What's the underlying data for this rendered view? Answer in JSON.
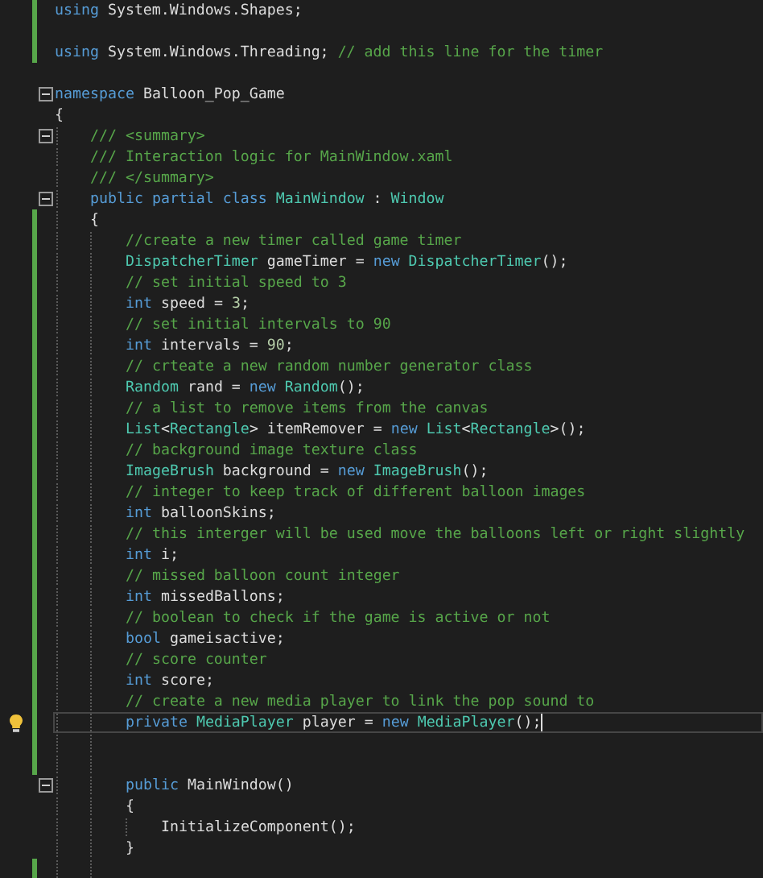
{
  "editor": {
    "lines": [
      {
        "tokens": [
          {
            "kind": "keyword",
            "text": "using"
          },
          {
            "kind": "plain",
            "text": " System.Windows.Shapes;"
          }
        ],
        "changed": true,
        "current": false
      },
      {
        "changed": true,
        "current": false
      },
      {
        "tokens": [
          {
            "kind": "keyword",
            "text": "using"
          },
          {
            "kind": "plain",
            "text": " System.Windows.Threading; "
          },
          {
            "kind": "comment",
            "text": "// add this line for the timer"
          }
        ],
        "changed": true,
        "current": false
      },
      {
        "changed": false,
        "current": false
      },
      {
        "tokens": [
          {
            "kind": "keyword",
            "text": "namespace"
          },
          {
            "kind": "plain",
            "text": " Balloon_Pop_Game"
          }
        ],
        "changed": false,
        "current": false,
        "expanded": true
      },
      {
        "tokens": [
          {
            "kind": "plain",
            "text": "{"
          }
        ],
        "changed": false,
        "current": false
      },
      {
        "block": [
          {
            "tokens": [
              {
                "kind": "comment",
                "text": "/// <summary>"
              }
            ],
            "changed": false,
            "current": false,
            "expanded": true
          },
          {
            "tokens": [
              {
                "kind": "comment",
                "text": "/// Interaction logic for MainWindow.xaml"
              }
            ],
            "changed": false,
            "current": false
          },
          {
            "tokens": [
              {
                "kind": "comment",
                "text": "/// </summary>"
              }
            ],
            "changed": false,
            "current": false
          },
          {
            "tokens": [
              {
                "kind": "keyword",
                "text": "public partial class"
              },
              {
                "kind": "type",
                "text": " MainWindow"
              },
              {
                "kind": "plain",
                "text": " : "
              },
              {
                "kind": "type",
                "text": "Window"
              }
            ],
            "changed": false,
            "current": false,
            "expanded": true
          },
          {
            "tokens": [
              {
                "kind": "plain",
                "text": "{"
              }
            ],
            "changed": true,
            "current": false
          },
          {
            "block": [
              {
                "tokens": [
                  {
                    "kind": "comment",
                    "text": "//create a new timer called game timer"
                  }
                ],
                "changed": true,
                "current": false
              },
              {
                "tokens": [
                  {
                    "kind": "type",
                    "text": "DispatcherTimer"
                  },
                  {
                    "kind": "plain",
                    "text": " gameTimer = "
                  },
                  {
                    "kind": "keyword",
                    "text": "new"
                  },
                  {
                    "kind": "type",
                    "text": " DispatcherTimer"
                  },
                  {
                    "kind": "plain",
                    "text": "();"
                  }
                ],
                "changed": true,
                "current": false
              },
              {
                "tokens": [
                  {
                    "kind": "comment",
                    "text": "// set initial speed to 3"
                  }
                ],
                "changed": true,
                "current": false
              },
              {
                "tokens": [
                  {
                    "kind": "keyword",
                    "text": "int"
                  },
                  {
                    "kind": "plain",
                    "text": " speed = "
                  },
                  {
                    "kind": "number",
                    "text": "3"
                  },
                  {
                    "kind": "plain",
                    "text": ";"
                  }
                ],
                "changed": true,
                "current": false
              },
              {
                "tokens": [
                  {
                    "kind": "comment",
                    "text": "// set initial intervals to 90"
                  }
                ],
                "changed": true,
                "current": false
              },
              {
                "tokens": [
                  {
                    "kind": "keyword",
                    "text": "int"
                  },
                  {
                    "kind": "plain",
                    "text": " intervals = "
                  },
                  {
                    "kind": "number",
                    "text": "90"
                  },
                  {
                    "kind": "plain",
                    "text": ";"
                  }
                ],
                "changed": true,
                "current": false
              },
              {
                "tokens": [
                  {
                    "kind": "comment",
                    "text": "// crteate a new random number generator class"
                  }
                ],
                "changed": true,
                "current": false
              },
              {
                "tokens": [
                  {
                    "kind": "type",
                    "text": "Random"
                  },
                  {
                    "kind": "plain",
                    "text": " rand = "
                  },
                  {
                    "kind": "keyword",
                    "text": "new"
                  },
                  {
                    "kind": "type",
                    "text": " Random"
                  },
                  {
                    "kind": "plain",
                    "text": "();"
                  }
                ],
                "changed": true,
                "current": false
              },
              {
                "tokens": [
                  {
                    "kind": "comment",
                    "text": "// a list to remove items from the canvas"
                  }
                ],
                "changed": true,
                "current": false
              },
              {
                "tokens": [
                  {
                    "kind": "type",
                    "text": "List"
                  },
                  {
                    "kind": "plain",
                    "text": "<"
                  },
                  {
                    "kind": "type",
                    "text": "Rectangle"
                  },
                  {
                    "kind": "plain",
                    "text": "> itemRemover = "
                  },
                  {
                    "kind": "keyword",
                    "text": "new"
                  },
                  {
                    "kind": "type",
                    "text": " List"
                  },
                  {
                    "kind": "plain",
                    "text": "<"
                  },
                  {
                    "kind": "type",
                    "text": "Rectangle"
                  },
                  {
                    "kind": "plain",
                    "text": ">();"
                  }
                ],
                "changed": true,
                "current": false
              },
              {
                "tokens": [
                  {
                    "kind": "comment",
                    "text": "// background image texture class"
                  }
                ],
                "changed": true,
                "current": false
              },
              {
                "tokens": [
                  {
                    "kind": "type",
                    "text": "ImageBrush"
                  },
                  {
                    "kind": "plain",
                    "text": " background = "
                  },
                  {
                    "kind": "keyword",
                    "text": "new"
                  },
                  {
                    "kind": "type",
                    "text": " ImageBrush"
                  },
                  {
                    "kind": "plain",
                    "text": "();"
                  }
                ],
                "changed": true,
                "current": false
              },
              {
                "tokens": [
                  {
                    "kind": "comment",
                    "text": "// integer to keep track of different balloon images"
                  }
                ],
                "changed": true,
                "current": false
              },
              {
                "tokens": [
                  {
                    "kind": "keyword",
                    "text": "int"
                  },
                  {
                    "kind": "plain",
                    "text": " balloonSkins;"
                  }
                ],
                "changed": true,
                "current": false
              },
              {
                "tokens": [
                  {
                    "kind": "comment",
                    "text": "// this interger will be used move the balloons left or right slightly"
                  }
                ],
                "changed": true,
                "current": false
              },
              {
                "tokens": [
                  {
                    "kind": "keyword",
                    "text": "int"
                  },
                  {
                    "kind": "plain",
                    "text": " i;"
                  }
                ],
                "changed": true,
                "current": false
              },
              {
                "tokens": [
                  {
                    "kind": "comment",
                    "text": "// missed balloon count integer"
                  }
                ],
                "changed": true,
                "current": false
              },
              {
                "tokens": [
                  {
                    "kind": "keyword",
                    "text": "int"
                  },
                  {
                    "kind": "plain",
                    "text": " missedBallons;"
                  }
                ],
                "changed": true,
                "current": false
              },
              {
                "tokens": [
                  {
                    "kind": "comment",
                    "text": "// boolean to check if the game is active or not"
                  }
                ],
                "changed": true,
                "current": false
              },
              {
                "tokens": [
                  {
                    "kind": "keyword",
                    "text": "bool"
                  },
                  {
                    "kind": "plain",
                    "text": " gameisactive;"
                  }
                ],
                "changed": true,
                "current": false
              },
              {
                "tokens": [
                  {
                    "kind": "comment",
                    "text": "// score counter"
                  }
                ],
                "changed": true,
                "current": false
              },
              {
                "tokens": [
                  {
                    "kind": "keyword",
                    "text": "int"
                  },
                  {
                    "kind": "plain",
                    "text": " score;"
                  }
                ],
                "changed": true,
                "current": false
              },
              {
                "tokens": [
                  {
                    "kind": "comment",
                    "text": "// create a new media player to link the pop sound to"
                  }
                ],
                "changed": true,
                "current": false
              },
              {
                "tokens": [
                  {
                    "kind": "keyword",
                    "text": "private"
                  },
                  {
                    "kind": "type",
                    "text": " MediaPlayer"
                  },
                  {
                    "kind": "plain",
                    "text": " player = "
                  },
                  {
                    "kind": "keyword",
                    "text": "new"
                  },
                  {
                    "kind": "type",
                    "text": " MediaPlayer"
                  },
                  {
                    "kind": "plain",
                    "text": "();"
                  }
                ],
                "changed": true,
                "current": true
              },
              {
                "changed": true,
                "current": false
              },
              {
                "changed": true,
                "current": false
              },
              {
                "tokens": [
                  {
                    "kind": "keyword",
                    "text": "public"
                  },
                  {
                    "kind": "plain",
                    "text": " MainWindow()"
                  }
                ],
                "changed": false,
                "current": false,
                "expanded": true
              },
              {
                "tokens": [
                  {
                    "kind": "plain",
                    "text": "{"
                  }
                ],
                "changed": false,
                "current": false
              },
              {
                "block": [
                  {
                    "tokens": [
                      {
                        "kind": "plain",
                        "text": "InitializeComponent();"
                      }
                    ],
                    "changed": false,
                    "current": false
                  }
                ]
              },
              {
                "tokens": [
                  {
                    "kind": "plain",
                    "text": "}"
                  }
                ],
                "changed": false,
                "current": false
              },
              {
                "changed": true,
                "current": false
              }
            ]
          }
        ]
      }
    ]
  }
}
